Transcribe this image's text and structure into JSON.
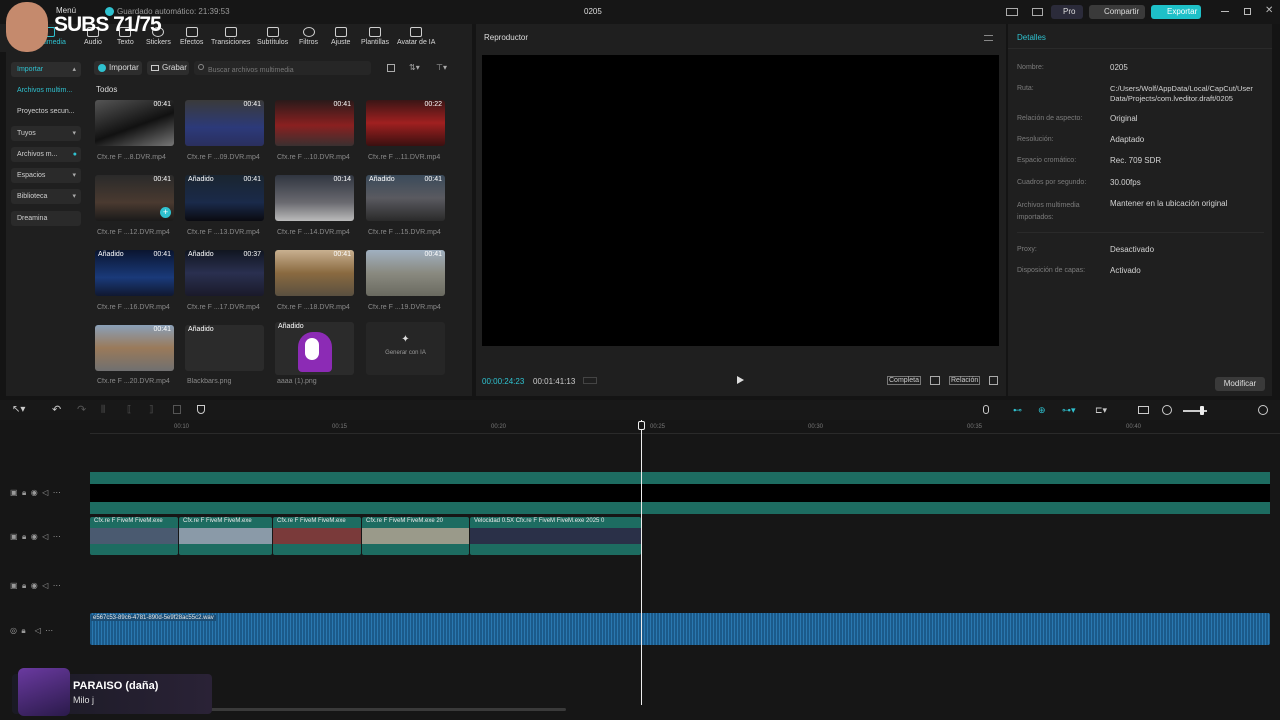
{
  "overlay": {
    "subs": "SUBS 71/75"
  },
  "topbar": {
    "menu": "Menú",
    "autosave": "Guardado automático: 21:39:53",
    "project": "0205",
    "pro": "Pro",
    "share": "Compartir",
    "export": "Exportar"
  },
  "toolbar": [
    "Multimedia",
    "Audio",
    "Texto",
    "Stickers",
    "Efectos",
    "Transiciones",
    "Subtítulos",
    "Filtros",
    "Ajuste",
    "Plantillas",
    "Avatar de IA"
  ],
  "nav": {
    "import": "Importar",
    "items": [
      "Archivos multim...",
      "Proyectos secun...",
      "Tuyos",
      "Archivos m...",
      "Espacios",
      "Biblioteca",
      "Dreamina"
    ]
  },
  "media": {
    "import_btn": "Importar",
    "record_btn": "Grabar",
    "search_placeholder": "Buscar archivos multimedia",
    "section": "Todos",
    "items": [
      {
        "name": "Cfx.re  F ...8.DVR.mp4",
        "dur": "00:41",
        "added": ""
      },
      {
        "name": "Cfx.re  F ...09.DVR.mp4",
        "dur": "00:41",
        "added": ""
      },
      {
        "name": "Cfx.re  F ...10.DVR.mp4",
        "dur": "00:41",
        "added": ""
      },
      {
        "name": "Cfx.re  F ...11.DVR.mp4",
        "dur": "00:22",
        "added": ""
      },
      {
        "name": "Cfx.re  F ...12.DVR.mp4",
        "dur": "00:41",
        "added": ""
      },
      {
        "name": "Cfx.re  F ...13.DVR.mp4",
        "dur": "00:41",
        "added": "Añadido"
      },
      {
        "name": "Cfx.re  F ...14.DVR.mp4",
        "dur": "00:14",
        "added": ""
      },
      {
        "name": "Cfx.re  F ...15.DVR.mp4",
        "dur": "00:41",
        "added": "Añadido"
      },
      {
        "name": "Cfx.re  F ...16.DVR.mp4",
        "dur": "00:41",
        "added": "Añadido"
      },
      {
        "name": "Cfx.re  F ...17.DVR.mp4",
        "dur": "00:37",
        "added": "Añadido"
      },
      {
        "name": "Cfx.re  F ...18.DVR.mp4",
        "dur": "00:41",
        "added": ""
      },
      {
        "name": "Cfx.re  F ...19.DVR.mp4",
        "dur": "00:41",
        "added": ""
      },
      {
        "name": "Cfx.re  F ...20.DVR.mp4",
        "dur": "00:41",
        "added": ""
      },
      {
        "name": "Blackbars.png",
        "dur": "",
        "added": "Añadido"
      },
      {
        "name": "aaaa (1).png",
        "dur": "",
        "added": "Añadido"
      }
    ],
    "generate": "Generar con IA"
  },
  "player": {
    "title": "Reproductor",
    "current": "00:00:24:23",
    "total": "00:01:41:13",
    "full": "Completa",
    "ratio": "Relación"
  },
  "details": {
    "title": "Detalles",
    "rows": [
      {
        "label": "Nombre:",
        "value": "0205"
      },
      {
        "label": "Ruta:",
        "value": "C:/Users/Wolf/AppData/Local/CapCut/User Data/Projects/com.lveditor.draft/0205"
      },
      {
        "label": "Relación de aspecto:",
        "value": "Original"
      },
      {
        "label": "Resolución:",
        "value": "Adaptado"
      },
      {
        "label": "Espacio cromático:",
        "value": "Rec. 709 SDR"
      },
      {
        "label": "Cuadros por segundo:",
        "value": "30.00fps"
      },
      {
        "label": "Archivos multimedia importados:",
        "value": "Mantener en la ubicación original"
      },
      {
        "label": "Proxy:",
        "value": "Desactivado"
      },
      {
        "label": "Disposición de capas:",
        "value": "Activado"
      }
    ],
    "modify": "Modificar"
  },
  "timeline": {
    "ticks": [
      "00:10",
      "00:15",
      "00:20",
      "00:25",
      "00:30",
      "00:35",
      "00:40"
    ],
    "clips": [
      "Cfx.re  F  FiveM  FiveM.exe",
      "Cfx.re  F  FiveM  FiveM.exe",
      "Cfx.re  F  FiveM  FiveM.exe",
      "Cfx.re  F  FiveM  FiveM.exe 20",
      "Velocidad 0.5X   Cfx.re  F  FiveM  FiveM.exe  2025 0"
    ],
    "audio": "e567c53-89c6-4781-890d-5e9f28ac55c2.wav"
  },
  "nowplaying": {
    "song": "PARAISO (daña)",
    "artist": "Milo j"
  }
}
